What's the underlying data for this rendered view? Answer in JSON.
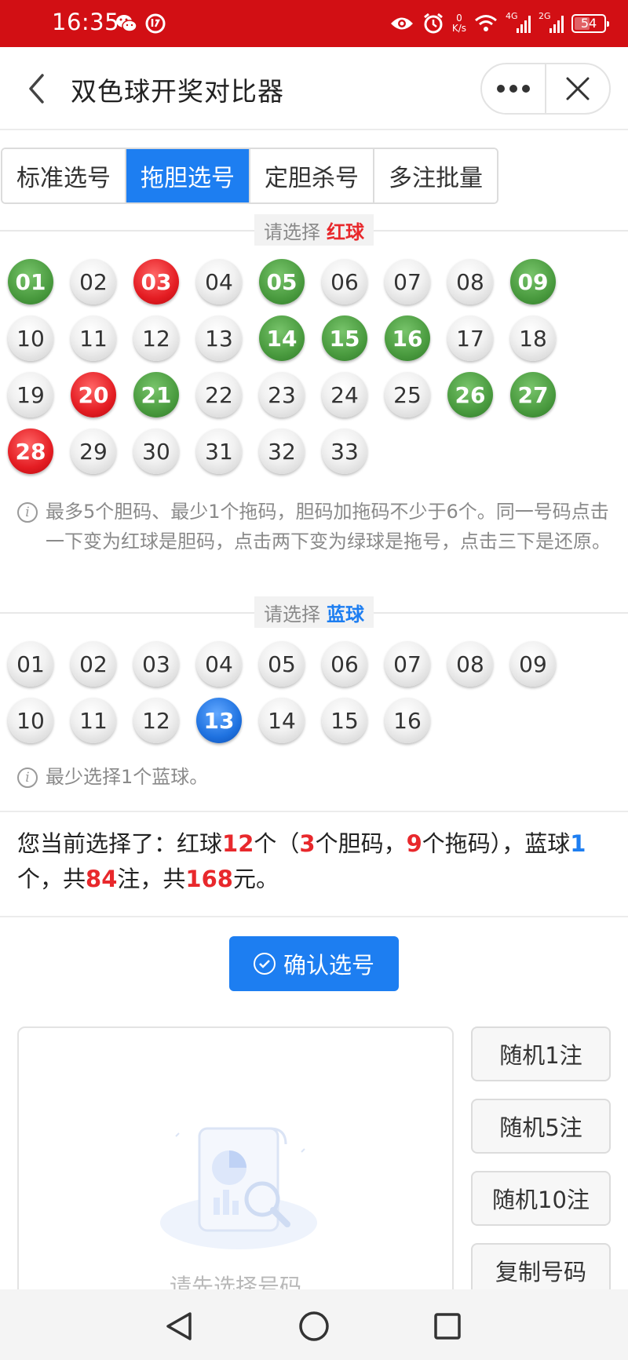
{
  "status_bar": {
    "time": "16:35",
    "net_speed_value": "0",
    "net_speed_unit": "K/s",
    "signal1_gen": "4G",
    "signal2_gen": "2G",
    "battery": "54",
    "battery_level": 0.54
  },
  "nav": {
    "title": "双色球开奖对比器"
  },
  "tabs": [
    {
      "label": "标准选号",
      "active": false
    },
    {
      "label": "拖胆选号",
      "active": true
    },
    {
      "label": "定胆杀号",
      "active": false
    },
    {
      "label": "多注批量",
      "active": false
    }
  ],
  "red_section": {
    "prefix": "请选择",
    "highlight": "红球",
    "balls": [
      {
        "n": "01",
        "state": "green"
      },
      {
        "n": "02",
        "state": "gray"
      },
      {
        "n": "03",
        "state": "red"
      },
      {
        "n": "04",
        "state": "gray"
      },
      {
        "n": "05",
        "state": "green"
      },
      {
        "n": "06",
        "state": "gray"
      },
      {
        "n": "07",
        "state": "gray"
      },
      {
        "n": "08",
        "state": "gray"
      },
      {
        "n": "09",
        "state": "green"
      },
      {
        "n": "10",
        "state": "gray"
      },
      {
        "n": "11",
        "state": "gray"
      },
      {
        "n": "12",
        "state": "gray"
      },
      {
        "n": "13",
        "state": "gray"
      },
      {
        "n": "14",
        "state": "green"
      },
      {
        "n": "15",
        "state": "green"
      },
      {
        "n": "16",
        "state": "green"
      },
      {
        "n": "17",
        "state": "gray"
      },
      {
        "n": "18",
        "state": "gray"
      },
      {
        "n": "19",
        "state": "gray"
      },
      {
        "n": "20",
        "state": "red"
      },
      {
        "n": "21",
        "state": "green"
      },
      {
        "n": "22",
        "state": "gray"
      },
      {
        "n": "23",
        "state": "gray"
      },
      {
        "n": "24",
        "state": "gray"
      },
      {
        "n": "25",
        "state": "gray"
      },
      {
        "n": "26",
        "state": "green"
      },
      {
        "n": "27",
        "state": "green"
      },
      {
        "n": "28",
        "state": "red"
      },
      {
        "n": "29",
        "state": "gray"
      },
      {
        "n": "30",
        "state": "gray"
      },
      {
        "n": "31",
        "state": "gray"
      },
      {
        "n": "32",
        "state": "gray"
      },
      {
        "n": "33",
        "state": "gray"
      }
    ],
    "note": "最多5个胆码、最少1个拖码，胆码加拖码不少于6个。同一号码点击一下变为红球是胆码，点击两下变为绿球是拖号，点击三下是还原。"
  },
  "blue_section": {
    "prefix": "请选择",
    "highlight": "蓝球",
    "balls": [
      {
        "n": "01",
        "state": "gray"
      },
      {
        "n": "02",
        "state": "gray"
      },
      {
        "n": "03",
        "state": "gray"
      },
      {
        "n": "04",
        "state": "gray"
      },
      {
        "n": "05",
        "state": "gray"
      },
      {
        "n": "06",
        "state": "gray"
      },
      {
        "n": "07",
        "state": "gray"
      },
      {
        "n": "08",
        "state": "gray"
      },
      {
        "n": "09",
        "state": "gray"
      },
      {
        "n": "10",
        "state": "gray"
      },
      {
        "n": "11",
        "state": "gray"
      },
      {
        "n": "12",
        "state": "gray"
      },
      {
        "n": "13",
        "state": "blue"
      },
      {
        "n": "14",
        "state": "gray"
      },
      {
        "n": "15",
        "state": "gray"
      },
      {
        "n": "16",
        "state": "gray"
      }
    ],
    "note": "最少选择1个蓝球。"
  },
  "summary": {
    "t1": "您当前选择了：红球",
    "red_count": "12",
    "t2": "个（",
    "dan_count": "3",
    "t3": "个胆码，",
    "tuo_count": "9",
    "t4": "个拖码），蓝球",
    "blue_count": "1",
    "t5": "个，共",
    "bets": "84",
    "t6": "注，共",
    "amount": "168",
    "t7": "元。"
  },
  "confirm_label": "确认选号",
  "empty_text": "请先选择号码",
  "side_buttons": [
    "随机1注",
    "随机5注",
    "随机10注",
    "复制号码"
  ],
  "colors": {
    "status_bar": "#d20f14",
    "accent_blue": "#1d7ef1",
    "red": "#e8282c",
    "green_ball": "#4a9b3f"
  }
}
